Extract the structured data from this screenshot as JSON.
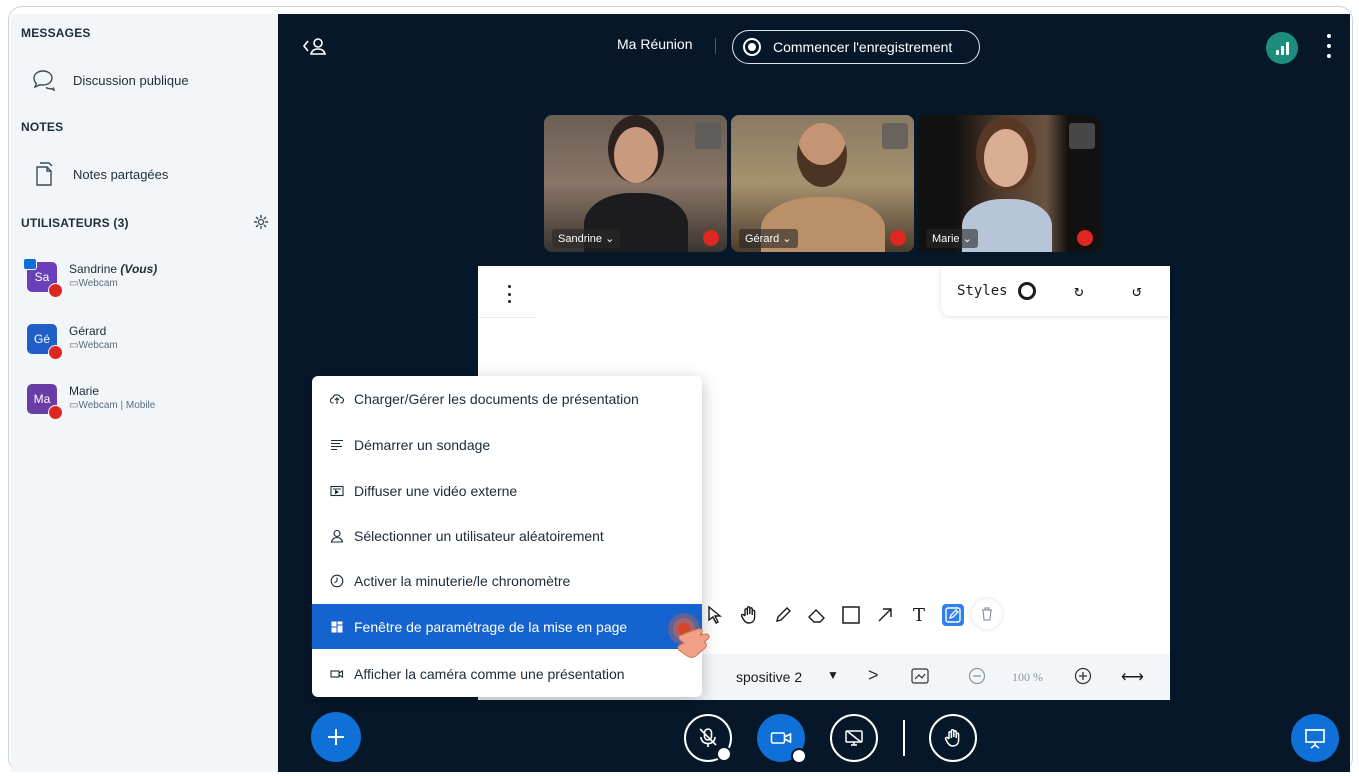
{
  "sidebar": {
    "messages_title": "MESSAGES",
    "public_chat_label": "Discussion publique",
    "notes_title": "NOTES",
    "shared_notes_label": "Notes partagées",
    "users_title": "UTILISATEURS (3)",
    "users": [
      {
        "initials": "Sa",
        "name": "Sandrine",
        "you_label": "(Vous)",
        "status": "Webcam",
        "color": "#6b3fb8"
      },
      {
        "initials": "Gé",
        "name": "Gérard",
        "you_label": "",
        "status": "Webcam",
        "color": "#1f5fc7"
      },
      {
        "initials": "Ma",
        "name": "Marie",
        "you_label": "",
        "status": "Webcam | Mobile",
        "color": "#6a3ca6"
      }
    ]
  },
  "header": {
    "meeting_title": "Ma Réunion",
    "record_label": "Commencer l'enregistrement"
  },
  "videos": [
    {
      "name": "Sandrine"
    },
    {
      "name": "Gérard"
    },
    {
      "name": "Marie"
    }
  ],
  "whiteboard": {
    "styles_label": "Styles",
    "slide_label": "spositive 2",
    "zoom_value": "100 %"
  },
  "menu": {
    "items": [
      {
        "label": "Charger/Gérer les documents de présentation",
        "icon": "upload-icon"
      },
      {
        "label": "Démarrer un sondage",
        "icon": "poll-icon"
      },
      {
        "label": "Diffuser une vidéo externe",
        "icon": "external-video-icon"
      },
      {
        "label": "Sélectionner un utilisateur aléatoirement",
        "icon": "user-icon"
      },
      {
        "label": "Activer la minuterie/le chronomètre",
        "icon": "timer-icon"
      },
      {
        "label": "Fenêtre de paramétrage de la mise en page",
        "icon": "layout-icon"
      },
      {
        "label": "Afficher la caméra comme une présentation",
        "icon": "camera-icon"
      }
    ]
  },
  "colors": {
    "accent": "#0f70d7",
    "background": "#06172a",
    "danger": "#df2721",
    "connection": "#1c8e7c"
  }
}
